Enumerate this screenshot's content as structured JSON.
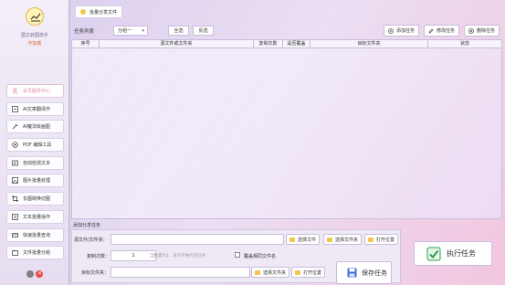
{
  "app": {
    "name": "图文转图高手",
    "status": "不加载"
  },
  "sidebar": {
    "items": [
      {
        "label": "会员服务中心",
        "icon": "user-icon",
        "active": true
      },
      {
        "label": "AI文章翻译作",
        "icon": "ai-text-icon"
      },
      {
        "label": "AI魔法绘画图",
        "icon": "magic-brush-icon"
      },
      {
        "label": "PDF 编辑工具",
        "icon": "pdf-icon"
      },
      {
        "label": "自动检测文本",
        "icon": "text-detect-icon"
      },
      {
        "label": "图片批量处理",
        "icon": "image-batch-icon"
      },
      {
        "label": "长图转换切图",
        "icon": "crop-icon"
      },
      {
        "label": "文本批量操作",
        "icon": "text-batch-icon"
      },
      {
        "label": "快速批量查询",
        "icon": "search-batch-icon"
      },
      {
        "label": "文件批量分组",
        "icon": "folder-group-icon"
      }
    ]
  },
  "topbar": {
    "tab_label": "批量分发文件"
  },
  "toolbar": {
    "title": "任务列表",
    "group_select": "分组一",
    "select_all": "全选",
    "invert": "反选",
    "add_task": "添加任务",
    "edit_task": "修改任务",
    "delete_task": "删除任务"
  },
  "table": {
    "columns": [
      "序号",
      "源文件或文件夹",
      "复制次数",
      "是否覆盖",
      "目标文件夹",
      "状态"
    ],
    "rows": []
  },
  "form": {
    "panel_title": "添加分发任务",
    "source_label": "源文件/文件夹：",
    "source_value": "",
    "select_file": "选择文件",
    "select_folder": "选择文件夹",
    "open_location": "打开位置",
    "copy_count_label": "复制次数：",
    "copy_count_value": "1",
    "copy_hint": "当数量为1，表示不执行该任务",
    "overwrite_label": "覆盖相同文件名",
    "target_label": "目标文件夹：",
    "target_value": "",
    "target_select_folder": "选择文件夹",
    "target_open_location": "打开位置",
    "save_task": "保存任务",
    "run_task": "执行任务"
  },
  "colors": {
    "accent_pink": "#e88aa8",
    "folder_yellow": "#f2c64e",
    "run_green": "#2e9f45",
    "save_blue": "#3c6fd8"
  }
}
